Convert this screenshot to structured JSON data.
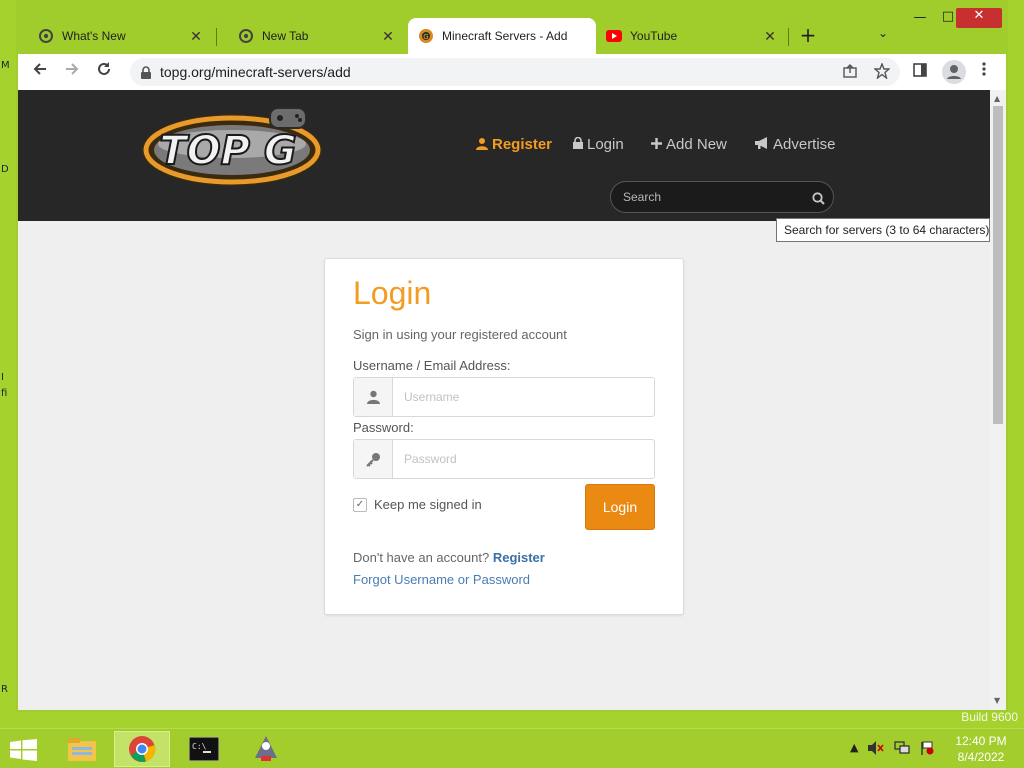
{
  "desktop": {
    "left_glyphs": [
      "M",
      "D",
      "I",
      "fi",
      "R"
    ],
    "build_text": "Build 9600"
  },
  "browser": {
    "tabs": [
      {
        "label": "What's New",
        "icon": "chrome-icon"
      },
      {
        "label": "New Tab",
        "icon": "chrome-icon"
      },
      {
        "label": "Minecraft Servers - Add",
        "icon": "topg-favicon"
      },
      {
        "label": "YouTube",
        "icon": "youtube-icon"
      }
    ],
    "new_tab_glyph": "+",
    "tab_search_glyph": "⌄",
    "window_controls": {
      "minimize": "—",
      "maximize": "□",
      "close": "✕"
    },
    "url": "topg.org/minecraft-servers/add"
  },
  "site": {
    "nav": {
      "register": "Register",
      "login": "Login",
      "add_new": "Add New",
      "advertise": "Advertise"
    },
    "search": {
      "placeholder": "Search"
    },
    "tooltip": "Search for servers (3 to 64 characters)",
    "logo_text": "TOP G"
  },
  "login_form": {
    "title": "Login",
    "subtitle": "Sign in using your registered account",
    "username_label": "Username / Email Address:",
    "username_placeholder": "Username",
    "password_label": "Password:",
    "password_placeholder": "Password",
    "keep_signed_in": "Keep me signed in",
    "keep_signed_in_checked": true,
    "login_button": "Login",
    "no_account_text": "Don't have an account?",
    "register_link": "Register",
    "forgot_link": "Forgot Username or Password"
  },
  "taskbar": {
    "apps": [
      "file-explorer-icon",
      "chrome-icon",
      "command-prompt-icon",
      "java-app-icon"
    ],
    "clock_time": "12:40 PM",
    "clock_date": "8/4/2022"
  },
  "colors": {
    "accent_orange": "#f39c22",
    "header_dark": "#272727",
    "link_blue": "#3a6fa8",
    "desktop_green": "#a6d22e"
  }
}
